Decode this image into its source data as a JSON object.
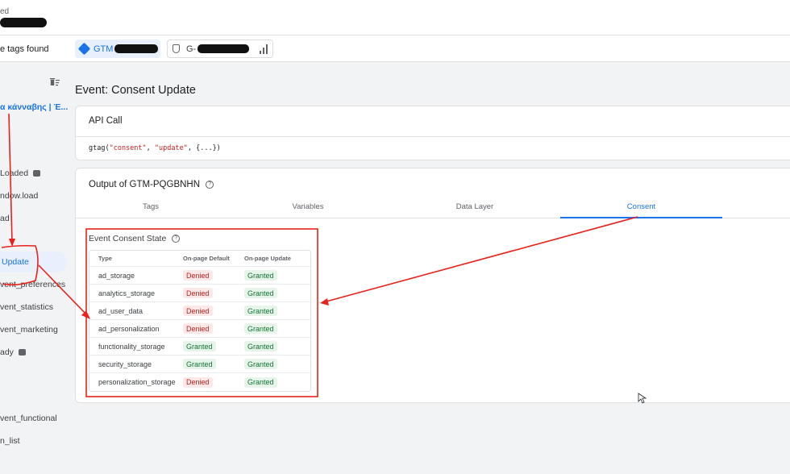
{
  "header": {
    "title_partial": "ed",
    "tags_found_partial": "e tags found"
  },
  "tagbar": {
    "gtm_label": "GTM",
    "ga_label": "G-"
  },
  "sidebar": {
    "items": [
      {
        "label": "α κάνναβης | Έ...",
        "link": true
      },
      {
        "label": "Loaded",
        "icon": "message-icon"
      },
      {
        "label": "ndow.load"
      },
      {
        "label": "ad"
      },
      {
        "label": "Update",
        "active": true
      },
      {
        "label": "vent_preferences"
      },
      {
        "label": "vent_statistics"
      },
      {
        "label": "vent_marketing"
      },
      {
        "label": "ady",
        "icon": "message-icon"
      },
      {
        "label": "vent_functional"
      },
      {
        "label": "n_list"
      }
    ]
  },
  "main": {
    "title": "Event: Consent Update",
    "api_call": {
      "heading": "API Call",
      "code_fn": "gtag(",
      "code_arg1": "\"consent\"",
      "code_sep": ", ",
      "code_arg2": "\"update\"",
      "code_rest": ", {...})"
    },
    "output": {
      "heading": "Output of GTM-PQGBNHN",
      "tabs": [
        "Tags",
        "Variables",
        "Data Layer",
        "Consent"
      ],
      "active_tab": "Consent",
      "consent_state_title": "Event Consent State",
      "columns": [
        "Type",
        "On-page Default",
        "On-page Update"
      ],
      "rows": [
        {
          "type": "ad_storage",
          "default": "Denied",
          "update": "Granted"
        },
        {
          "type": "analytics_storage",
          "default": "Denied",
          "update": "Granted"
        },
        {
          "type": "ad_user_data",
          "default": "Denied",
          "update": "Granted"
        },
        {
          "type": "ad_personalization",
          "default": "Denied",
          "update": "Granted"
        },
        {
          "type": "functionality_storage",
          "default": "Granted",
          "update": "Granted"
        },
        {
          "type": "security_storage",
          "default": "Granted",
          "update": "Granted"
        },
        {
          "type": "personalization_storage",
          "default": "Denied",
          "update": "Granted"
        }
      ]
    }
  },
  "colors": {
    "accent": "#1a73e8",
    "denied_bg": "#fce8e6",
    "denied_text": "#c5221f",
    "granted_bg": "#e6f4ea",
    "granted_text": "#137333",
    "annotation": "#e8221b"
  }
}
